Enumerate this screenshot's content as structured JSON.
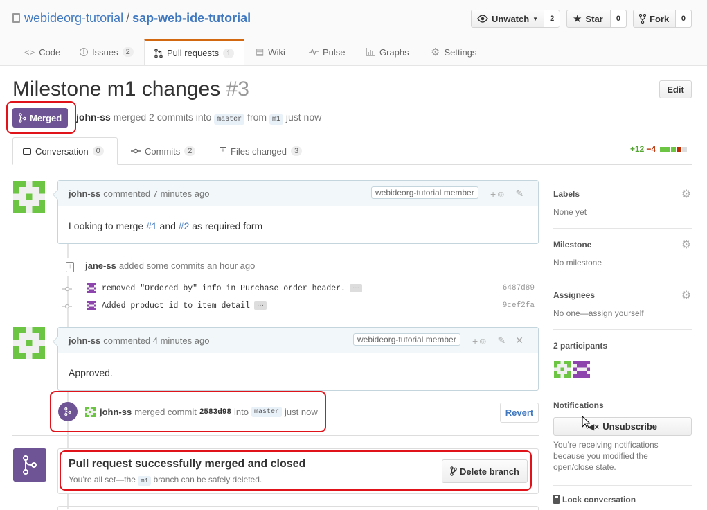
{
  "repo": {
    "owner": "webideorg-tutorial",
    "separator": "/",
    "name": "sap-web-ide-tutorial"
  },
  "actions": {
    "watch": {
      "label": "Unwatch",
      "count": "2"
    },
    "star": {
      "label": "Star",
      "count": "0"
    },
    "fork": {
      "label": "Fork",
      "count": "0"
    }
  },
  "tabs": [
    {
      "label": "Code",
      "count": ""
    },
    {
      "label": "Issues",
      "count": "2"
    },
    {
      "label": "Pull requests",
      "count": "1"
    },
    {
      "label": "Wiki",
      "count": ""
    },
    {
      "label": "Pulse",
      "count": ""
    },
    {
      "label": "Graphs",
      "count": ""
    },
    {
      "label": "Settings",
      "count": ""
    }
  ],
  "pr": {
    "title": "Milestone m1 changes",
    "number": "#3",
    "edit_label": "Edit",
    "state": "Merged",
    "author": "john-ss",
    "merged_text": "merged 2 commits into",
    "base": "master",
    "from_text": "from",
    "head": "m1",
    "when": "just now"
  },
  "pr_tabs": [
    {
      "label": "Conversation",
      "count": "0"
    },
    {
      "label": "Commits",
      "count": "2"
    },
    {
      "label": "Files changed",
      "count": "3"
    }
  ],
  "diffstat": {
    "additions": "+12",
    "deletions": "−4"
  },
  "comment1": {
    "author": "john-ss",
    "when": "commented 7 minutes ago",
    "badge": "webideorg-tutorial member",
    "body_prefix": "Looking to merge ",
    "ref1": "#1",
    "body_mid": " and ",
    "ref2": "#2",
    "body_suffix": " as required form"
  },
  "commits_event": {
    "author": "jane-ss",
    "text": "added some commits an hour ago"
  },
  "commits": [
    {
      "message": "removed \"Ordered by\" info in Purchase order header.",
      "sha": "6487d89"
    },
    {
      "message": "Added product id to item detail",
      "sha": "9cef2fa"
    }
  ],
  "comment2": {
    "author": "john-ss",
    "when": "commented 4 minutes ago",
    "badge": "webideorg-tutorial member",
    "body": "Approved."
  },
  "merge_event": {
    "author": "john-ss",
    "text": "merged commit",
    "sha": "2583d98",
    "into": "into",
    "base": "master",
    "when": "just now",
    "revert_label": "Revert"
  },
  "merged_box": {
    "title": "Pull request successfully merged and closed",
    "desc_prefix": "You’re all set—the",
    "branch": "m1",
    "desc_suffix": "branch can be safely deleted.",
    "button": "Delete branch"
  },
  "sidebar": {
    "labels": {
      "heading": "Labels",
      "value": "None yet"
    },
    "milestone": {
      "heading": "Milestone",
      "value": "No milestone"
    },
    "assignees": {
      "heading": "Assignees",
      "value": "No one—assign yourself"
    },
    "participants": {
      "heading": "2 participants"
    },
    "notifications": {
      "heading": "Notifications",
      "button": "Unsubscribe",
      "text": "You’re receiving notifications because you modified the open/close state."
    },
    "lock": "Lock conversation"
  },
  "colors": {
    "merged": "#6e5494",
    "link": "#4078c0",
    "highlight": "#e0131b",
    "additions": "#55a532",
    "deletions": "#bd2c00"
  }
}
